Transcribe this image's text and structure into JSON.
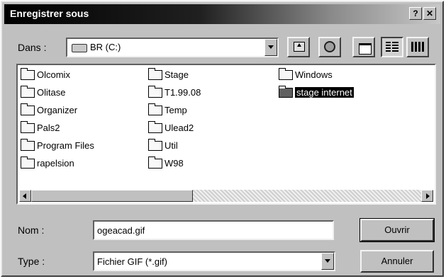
{
  "window": {
    "title": "Enregistrer sous"
  },
  "titlebar": {
    "help_glyph": "?",
    "close_glyph": "✕"
  },
  "lookin": {
    "label": "Dans :",
    "value": "BR (C:)",
    "icon": "drive-icon"
  },
  "toolbar": {
    "buttons": [
      {
        "name": "up-one-level",
        "icon": "folder-up-icon"
      },
      {
        "name": "desktop",
        "icon": "desktop-icon"
      },
      {
        "name": "new-folder",
        "icon": "new-folder-icon"
      },
      {
        "name": "list-view",
        "icon": "list-view-icon"
      },
      {
        "name": "details-view",
        "icon": "details-view-icon"
      }
    ]
  },
  "files": [
    {
      "name": "Olcomix",
      "icon": "folder-icon",
      "selected": false
    },
    {
      "name": "Olitase",
      "icon": "folder-icon",
      "selected": false
    },
    {
      "name": "Organizer",
      "icon": "folder-icon",
      "selected": false
    },
    {
      "name": "Pals2",
      "icon": "folder-icon",
      "selected": false
    },
    {
      "name": "Program Files",
      "icon": "folder-icon",
      "selected": false
    },
    {
      "name": "rapelsion",
      "icon": "folder-icon",
      "selected": false
    },
    {
      "name": "Stage",
      "icon": "folder-icon",
      "selected": false
    },
    {
      "name": "T1.99.08",
      "icon": "folder-icon",
      "selected": false
    },
    {
      "name": "Temp",
      "icon": "folder-icon",
      "selected": false
    },
    {
      "name": "Ulead2",
      "icon": "folder-icon",
      "selected": false
    },
    {
      "name": "Util",
      "icon": "folder-icon",
      "selected": false
    },
    {
      "name": "W98",
      "icon": "folder-icon",
      "selected": false
    },
    {
      "name": "Windows",
      "icon": "folder-icon",
      "selected": false
    },
    {
      "name": "stage internet",
      "icon": "folder-icon",
      "selected": true
    }
  ],
  "filename": {
    "label": "Nom :",
    "value": "ogeacad.gif"
  },
  "filetype": {
    "label": "Type :",
    "value": "Fichier GIF (*.gif)"
  },
  "buttons": {
    "open": "Ouvrir",
    "cancel": "Annuler"
  },
  "colors": {
    "face": "#c0c0c0",
    "selection": "#000000",
    "title_start": "#000000"
  }
}
